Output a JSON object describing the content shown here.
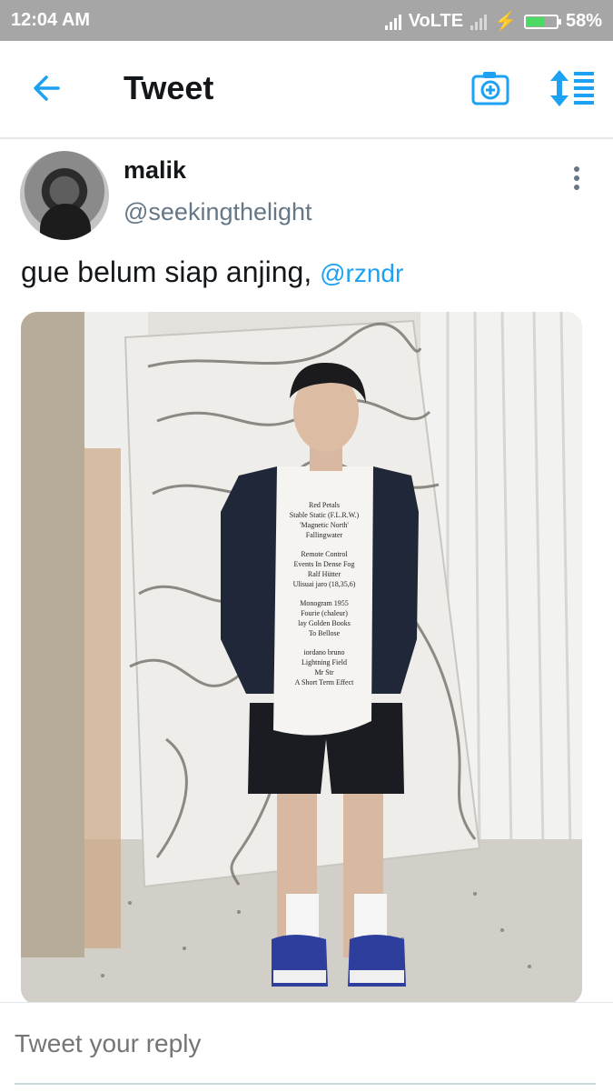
{
  "status_bar": {
    "time": "12:04 AM",
    "network": "VoLTE",
    "battery": "58%",
    "battery_level": 0.58
  },
  "header": {
    "title": "Tweet",
    "back_icon": "arrow-left-icon",
    "camera_icon": "camera-plus-icon",
    "sort_icon": "sort-list-icon",
    "accent_color": "#1da1f2"
  },
  "tweet": {
    "author_name": "malik",
    "author_handle": "@seekingthelight",
    "text": "gue belum siap anjing,",
    "mention": "@rzndr",
    "shirt_text": [
      "Red Petals",
      "Stable Static (F.L.R.W.)",
      "'Magnetic North'",
      "Fallingwater",
      "Remote Control",
      "Events In Dense Fog",
      "Ralf Hütter",
      "Ulisuai jaro (18,35,6)",
      "Monogram 1955",
      "Fourie (chaleur)",
      "lay Golden Books",
      "To Bellose",
      "iordano bruno",
      "Lightning Field",
      "Mr Str",
      "A Short Term Effect"
    ]
  },
  "reply": {
    "placeholder": "Tweet your reply"
  }
}
